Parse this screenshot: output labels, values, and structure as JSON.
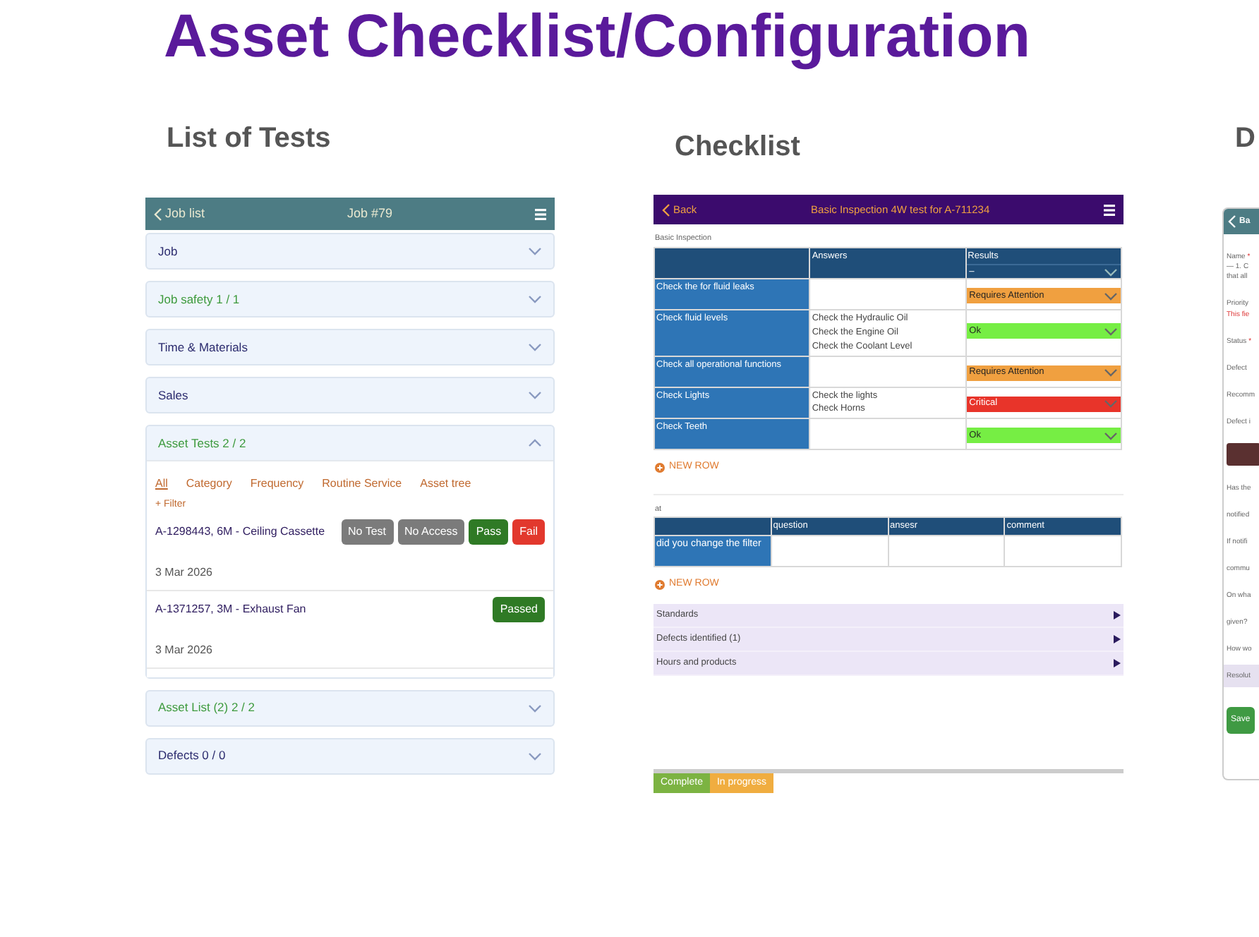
{
  "page_title": "Asset Checklist/Configuration",
  "list_of_tests": {
    "heading": "List of Tests",
    "app_bar": {
      "back_label": "Job list",
      "title": "Job #79"
    },
    "accordion": [
      {
        "label": "Job",
        "complete": false,
        "expanded": false
      },
      {
        "label": "Job safety 1 / 1",
        "complete": true,
        "expanded": false
      },
      {
        "label": "Time & Materials",
        "complete": false,
        "expanded": false
      },
      {
        "label": "Sales",
        "complete": false,
        "expanded": false
      },
      {
        "label": "Asset Tests 2 / 2",
        "complete": true,
        "expanded": true,
        "filters": [
          {
            "label": "All",
            "selected": true
          },
          {
            "label": "Category",
            "selected": false
          },
          {
            "label": "Frequency",
            "selected": false
          },
          {
            "label": "Routine Service",
            "selected": false
          },
          {
            "label": "Asset tree",
            "selected": false
          }
        ],
        "add_filter": "+ Filter",
        "tests": [
          {
            "name": "A-1298443, 6M - Ceiling Cassette",
            "date": "3 Mar 2026",
            "buttons": [
              {
                "label": "No Test",
                "kind": "neutral"
              },
              {
                "label": "No Access",
                "kind": "neutral"
              },
              {
                "label": "Pass",
                "kind": "pass"
              },
              {
                "label": "Fail",
                "kind": "fail"
              }
            ]
          },
          {
            "name": "A-1371257, 3M - Exhaust Fan",
            "date": "3 Mar 2026",
            "buttons": [
              {
                "label": "Passed",
                "kind": "pass"
              }
            ]
          }
        ]
      },
      {
        "label": "Asset List (2) 2 / 2",
        "complete": true,
        "expanded": false
      },
      {
        "label": "Defects 0 / 0",
        "complete": false,
        "expanded": false
      }
    ]
  },
  "checklist": {
    "heading": "Checklist",
    "app_bar": {
      "back_label": "Back",
      "title": "Basic Inspection 4W test for A-711234"
    },
    "group_label": "Basic Inspection",
    "columns": [
      "Answers",
      "Results"
    ],
    "results_filter": "–",
    "rows": [
      {
        "item": "Check the for fluid leaks",
        "result": {
          "value": "Requires Attention",
          "kind": "attention"
        }
      },
      {
        "item": "Check fluid levels",
        "answers": [
          "Check the Hydraulic Oil",
          "Check the Engine Oil",
          "Check the Coolant Level"
        ],
        "result": {
          "value": "Ok",
          "kind": "ok"
        }
      },
      {
        "item": "Check all operational functions",
        "result": {
          "value": "Requires Attention",
          "kind": "attention"
        }
      },
      {
        "item": "Check Lights",
        "answers": [
          "Check the lights",
          "Check Horns"
        ],
        "result": {
          "value": "Critical",
          "kind": "critical"
        }
      },
      {
        "item": "Check Teeth",
        "result": {
          "value": "Ok",
          "kind": "ok"
        }
      }
    ],
    "new_row_label": "NEW ROW",
    "table2": {
      "label": "at",
      "columns": [
        "question",
        "ansesr",
        "comment"
      ],
      "rows": [
        {
          "item": "did you change the filter"
        }
      ],
      "new_row_label": "NEW ROW"
    },
    "panels": [
      {
        "label": "Standards",
        "expanded": false
      },
      {
        "label": "Defects identified (1)",
        "expanded": false
      },
      {
        "label": "Hours and products",
        "expanded": false
      }
    ],
    "status_tabs": [
      {
        "label": "Complete",
        "kind": "complete"
      },
      {
        "label": "In progress",
        "kind": "in-progress"
      }
    ]
  },
  "defect_panel": {
    "heading": "D",
    "back_label": "Ba",
    "lines": [
      {
        "text": "Name",
        "kind": "label",
        "mark": "*"
      },
      {
        "text": "— 1. C",
        "kind": "value"
      },
      {
        "text": "that all",
        "kind": "value"
      },
      {
        "text": "Priority",
        "kind": "label"
      },
      {
        "text": "This fie",
        "kind": "error"
      },
      {
        "text": "Status",
        "kind": "label",
        "mark": "*"
      },
      {
        "text": "Defect",
        "kind": "label"
      },
      {
        "text": "Recomm",
        "kind": "label"
      },
      {
        "text": "Defect i",
        "kind": "label"
      },
      {
        "kind": "photo"
      },
      {
        "text": "Has the",
        "kind": "label"
      },
      {
        "text": "notified",
        "kind": "label"
      },
      {
        "text": "If notifi",
        "kind": "label"
      },
      {
        "text": "commu",
        "kind": "label"
      },
      {
        "text": "On wha",
        "kind": "label"
      },
      {
        "text": "given?",
        "kind": "label"
      },
      {
        "text": "How wo",
        "kind": "label"
      },
      {
        "text": "Resolut",
        "kind": "section"
      }
    ],
    "save_label": "Save"
  }
}
